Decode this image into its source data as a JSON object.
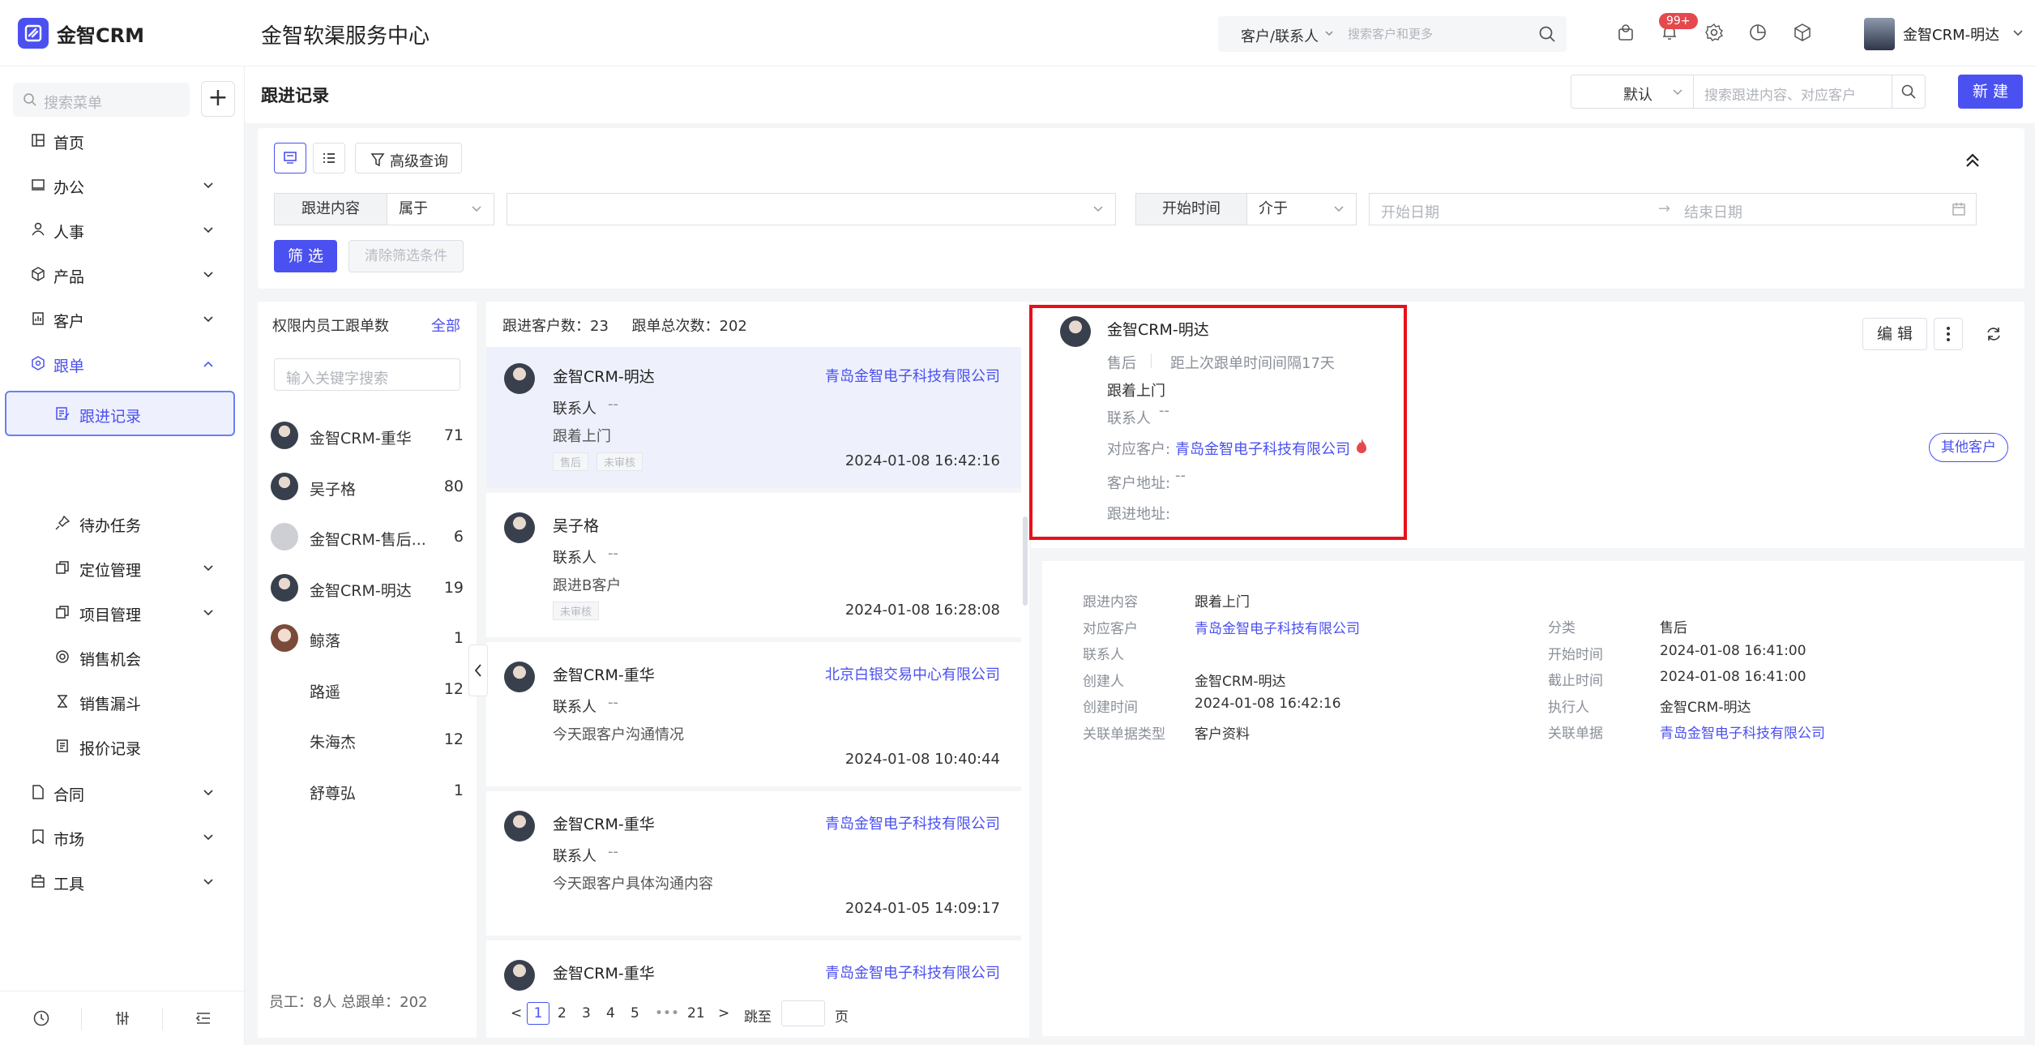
{
  "app": {
    "name": "金智CRM",
    "portal_title": "金智软渠服务中心"
  },
  "topbar": {
    "search_scope": "客户/联系人",
    "search_placeholder": "搜索客户和更多",
    "notification_badge": "99+",
    "user_name": "金智CRM-明达"
  },
  "sidebar": {
    "search_placeholder": "搜索菜单",
    "items": [
      {
        "label": "首页",
        "icon": "home-icon"
      },
      {
        "label": "办公",
        "icon": "office-icon"
      },
      {
        "label": "人事",
        "icon": "people-icon"
      },
      {
        "label": "产品",
        "icon": "box-icon"
      },
      {
        "label": "客户",
        "icon": "customer-icon"
      },
      {
        "label": "跟单",
        "icon": "follow-icon"
      },
      {
        "label": "跟进记录",
        "icon": "record-icon"
      },
      {
        "label": "待办任务",
        "icon": "pin-icon"
      },
      {
        "label": "定位管理",
        "icon": "copy-icon"
      },
      {
        "label": "项目管理",
        "icon": "copy-icon"
      },
      {
        "label": "销售机会",
        "icon": "target-icon"
      },
      {
        "label": "销售漏斗",
        "icon": "funnel-icon"
      },
      {
        "label": "报价记录",
        "icon": "doc-icon"
      },
      {
        "label": "合同",
        "icon": "contract-icon"
      },
      {
        "label": "市场",
        "icon": "market-icon"
      },
      {
        "label": "工具",
        "icon": "toolbox-icon"
      }
    ]
  },
  "header": {
    "title": "跟进记录",
    "sort_value": "默认",
    "search_placeholder": "搜索跟进内容、对应客户",
    "new_label": "新 建"
  },
  "filter": {
    "advanced_label": "高级查询",
    "content_label": "跟进内容",
    "content_op": "属于",
    "time_label": "开始时间",
    "time_op": "介于",
    "start_placeholder": "开始日期",
    "arrow": "→",
    "end_placeholder": "结束日期",
    "filter_btn": "筛 选",
    "clear_btn": "清除筛选条件"
  },
  "employees": {
    "title": "权限内员工跟单数",
    "all_label": "全部",
    "search_placeholder": "输入关键字搜索",
    "list": [
      {
        "name": "金智CRM-重华",
        "count": "71",
        "avatar": "man"
      },
      {
        "name": "吴子格",
        "count": "80",
        "avatar": "man"
      },
      {
        "name": "金智CRM-售后...",
        "count": "6",
        "avatar": "grey"
      },
      {
        "name": "金智CRM-明达",
        "count": "19",
        "avatar": "man"
      },
      {
        "name": "鲸落",
        "count": "1",
        "avatar": "girl"
      },
      {
        "name": "路遥",
        "count": "12",
        "avatar": "none"
      },
      {
        "name": "朱海杰",
        "count": "12",
        "avatar": "none"
      },
      {
        "name": "舒尊弘",
        "count": "1",
        "avatar": "none"
      }
    ],
    "footer": "员工：8人 总跟单：202"
  },
  "records": {
    "stats": "跟进客户数：23     跟单总次数：202",
    "contact_label": "联系人",
    "dash": "--",
    "items": [
      {
        "name": "金智CRM-明达",
        "customer": "青岛金智电子科技有限公司",
        "content": "跟着上门",
        "tags": [
          "售后",
          "未审核"
        ],
        "time": "2024-01-08 16:42:16"
      },
      {
        "name": "吴子格",
        "customer": "",
        "content": "跟进B客户",
        "tags": [
          "未审核"
        ],
        "time": "2024-01-08 16:28:08"
      },
      {
        "name": "金智CRM-重华",
        "customer": "北京白银交易中心有限公司",
        "content": "今天跟客户沟通情况",
        "tags": [],
        "time": "2024-01-08 10:40:44"
      },
      {
        "name": "金智CRM-重华",
        "customer": "青岛金智电子科技有限公司",
        "content": "今天跟客户具体沟通内容",
        "tags": [],
        "time": "2024-01-05 14:09:17"
      },
      {
        "name": "金智CRM-重华",
        "customer": "青岛金智电子科技有限公司",
        "content": "",
        "tags": [],
        "time": ""
      }
    ]
  },
  "pagination": {
    "pages": [
      "1",
      "2",
      "3",
      "4",
      "5",
      "•••",
      "21"
    ],
    "prev": "<",
    "next": ">",
    "jump_label": "跳至",
    "page_label": "页"
  },
  "detail": {
    "name": "金智CRM-明达",
    "category": "售后",
    "since_last": "距上次跟单时间间隔17天",
    "content": "跟着上门",
    "contact_label": "联系人",
    "contact_value": "--",
    "customer_label": "对应客户:",
    "customer_value": "青岛金智电子科技有限公司",
    "address_label": "客户地址:",
    "address_value": "--",
    "follow_address_label": "跟进地址:",
    "edit_label": "编 辑",
    "other_customers": "其他客户",
    "fields_left": [
      {
        "key": "跟进内容",
        "value": "跟着上门",
        "link": false
      },
      {
        "key": "对应客户",
        "value": "青岛金智电子科技有限公司",
        "link": true
      },
      {
        "key": "联系人",
        "value": "",
        "link": false
      },
      {
        "key": "创建人",
        "value": "金智CRM-明达",
        "link": false
      },
      {
        "key": "创建时间",
        "value": "2024-01-08 16:42:16",
        "link": false
      },
      {
        "key": "关联单据类型",
        "value": "客户资料",
        "link": false
      }
    ],
    "fields_right": [
      {
        "key": "分类",
        "value": "售后",
        "link": false
      },
      {
        "key": "开始时间",
        "value": "2024-01-08 16:41:00",
        "link": false
      },
      {
        "key": "截止时间",
        "value": "2024-01-08 16:41:00",
        "link": false
      },
      {
        "key": "执行人",
        "value": "金智CRM-明达",
        "link": false
      },
      {
        "key": "关联单据",
        "value": "青岛金智电子科技有限公司",
        "link": true
      }
    ]
  },
  "colors": {
    "accent": "#4b50f0",
    "highlight": "#e8101a",
    "badge": "#e5484d"
  }
}
